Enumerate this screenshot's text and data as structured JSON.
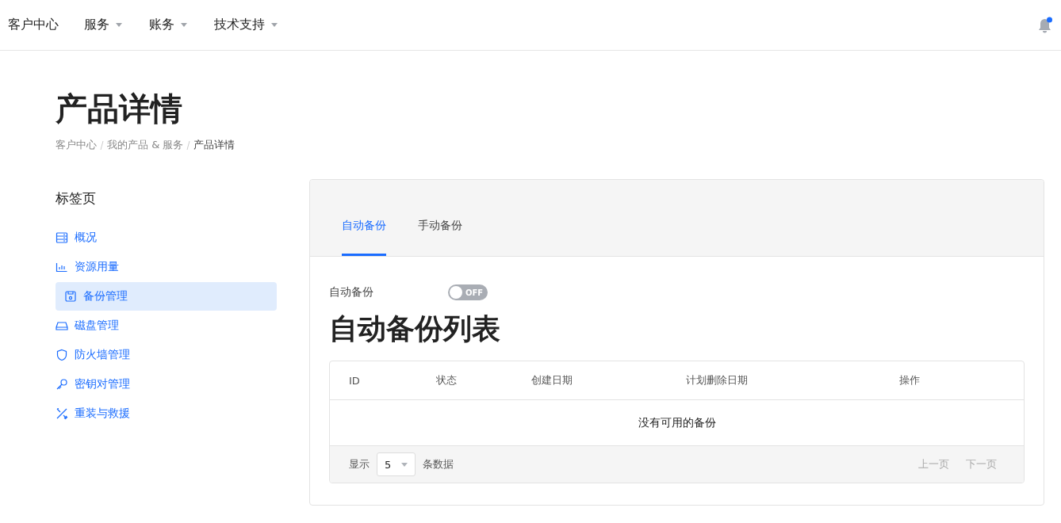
{
  "nav": {
    "brand": "客户中心",
    "menus": [
      {
        "label": "服务"
      },
      {
        "label": "账务"
      },
      {
        "label": "技术支持"
      }
    ],
    "notifications": {
      "unread": true
    }
  },
  "page": {
    "title": "产品详情",
    "breadcrumb": [
      "客户中心",
      "我的产品 & 服务",
      "产品详情"
    ]
  },
  "sidebar": {
    "title": "标签页",
    "items": [
      {
        "label": "概况",
        "selected": false
      },
      {
        "label": "资源用量",
        "selected": false
      },
      {
        "label": "备份管理",
        "selected": true
      },
      {
        "label": "磁盘管理",
        "selected": false
      },
      {
        "label": "防火墙管理",
        "selected": false
      },
      {
        "label": "密钥对管理",
        "selected": false
      },
      {
        "label": "重装与救援",
        "selected": false
      }
    ]
  },
  "tabs": [
    {
      "label": "自动备份",
      "selected": true
    },
    {
      "label": "手动备份",
      "selected": false
    }
  ],
  "auto_backup": {
    "label": "自动备份",
    "on": false,
    "toggle_text": "OFF"
  },
  "list_title": "自动备份列表",
  "table": {
    "columns": [
      "ID",
      "状态",
      "创建日期",
      "计划删除日期",
      "操作"
    ],
    "empty_text": "没有可用的备份",
    "footer": {
      "show_label": "显示",
      "page_size": "5",
      "rows_label": "条数据",
      "prev": {
        "label": "上一页",
        "disabled": true
      },
      "next": {
        "label": "下一页",
        "disabled": true
      }
    }
  }
}
